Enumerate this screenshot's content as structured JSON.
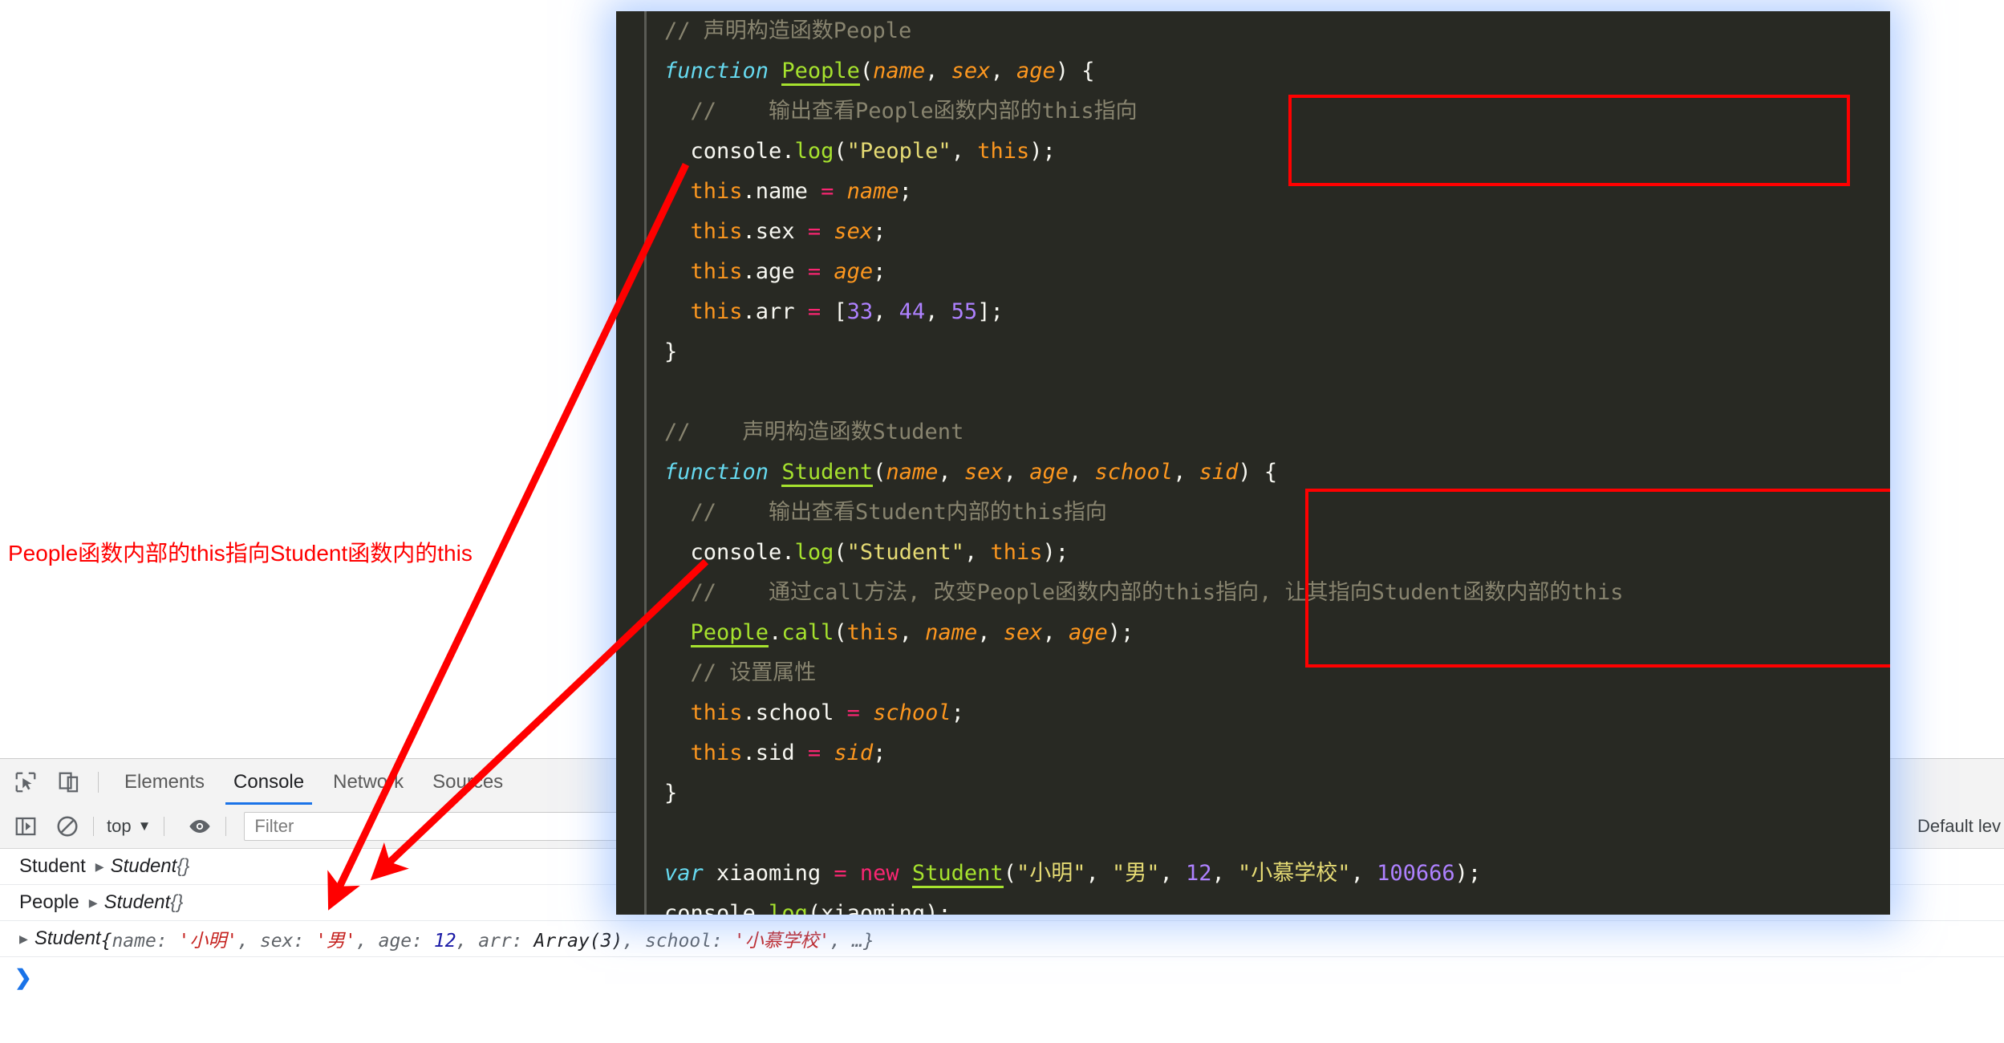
{
  "code_panel": {
    "language": "javascript",
    "background_color": "#282923",
    "glow_color": "#78aaff",
    "lines": [
      {
        "tokens": [
          {
            "t": "// 声明构造函数People",
            "c": "c-com"
          }
        ],
        "indent": 0
      },
      {
        "tokens": [
          {
            "t": "function ",
            "c": "c-kw"
          },
          {
            "t": "People",
            "c": "c-fn"
          },
          {
            "t": "(",
            "c": "c-punc"
          },
          {
            "t": "name",
            "c": "c-par"
          },
          {
            "t": ", ",
            "c": "c-punc"
          },
          {
            "t": "sex",
            "c": "c-par"
          },
          {
            "t": ", ",
            "c": "c-punc"
          },
          {
            "t": "age",
            "c": "c-par"
          },
          {
            "t": ") {",
            "c": "c-punc"
          }
        ],
        "indent": 0
      },
      {
        "tokens": [
          {
            "t": "//    输出查看People函数内部的this指向",
            "c": "c-com"
          }
        ],
        "indent": 1
      },
      {
        "tokens": [
          {
            "t": "console",
            "c": "c-plain"
          },
          {
            "t": ".",
            "c": "c-punc"
          },
          {
            "t": "log",
            "c": "c-fn2"
          },
          {
            "t": "(",
            "c": "c-punc"
          },
          {
            "t": "\"People\"",
            "c": "c-str"
          },
          {
            "t": ", ",
            "c": "c-punc"
          },
          {
            "t": "this",
            "c": "c-this"
          },
          {
            "t": ");",
            "c": "c-punc"
          }
        ],
        "indent": 1
      },
      {
        "tokens": [
          {
            "t": "this",
            "c": "c-this"
          },
          {
            "t": ".name ",
            "c": "c-plain"
          },
          {
            "t": "= ",
            "c": "c-op"
          },
          {
            "t": "name",
            "c": "c-par"
          },
          {
            "t": ";",
            "c": "c-punc"
          }
        ],
        "indent": 1
      },
      {
        "tokens": [
          {
            "t": "this",
            "c": "c-this"
          },
          {
            "t": ".sex ",
            "c": "c-plain"
          },
          {
            "t": "= ",
            "c": "c-op"
          },
          {
            "t": "sex",
            "c": "c-par"
          },
          {
            "t": ";",
            "c": "c-punc"
          }
        ],
        "indent": 1
      },
      {
        "tokens": [
          {
            "t": "this",
            "c": "c-this"
          },
          {
            "t": ".age ",
            "c": "c-plain"
          },
          {
            "t": "= ",
            "c": "c-op"
          },
          {
            "t": "age",
            "c": "c-par"
          },
          {
            "t": ";",
            "c": "c-punc"
          }
        ],
        "indent": 1
      },
      {
        "tokens": [
          {
            "t": "this",
            "c": "c-this"
          },
          {
            "t": ".arr ",
            "c": "c-plain"
          },
          {
            "t": "= ",
            "c": "c-op"
          },
          {
            "t": "[",
            "c": "c-punc"
          },
          {
            "t": "33",
            "c": "c-num"
          },
          {
            "t": ", ",
            "c": "c-punc"
          },
          {
            "t": "44",
            "c": "c-num"
          },
          {
            "t": ", ",
            "c": "c-punc"
          },
          {
            "t": "55",
            "c": "c-num"
          },
          {
            "t": "];",
            "c": "c-punc"
          }
        ],
        "indent": 1
      },
      {
        "tokens": [
          {
            "t": "}",
            "c": "c-punc"
          }
        ],
        "indent": 0
      },
      {
        "tokens": [
          {
            "t": "",
            "c": "c-plain"
          }
        ],
        "indent": 0
      },
      {
        "tokens": [
          {
            "t": "//    声明构造函数Student",
            "c": "c-com"
          }
        ],
        "indent": 0
      },
      {
        "tokens": [
          {
            "t": "function ",
            "c": "c-kw"
          },
          {
            "t": "Student",
            "c": "c-fn"
          },
          {
            "t": "(",
            "c": "c-punc"
          },
          {
            "t": "name",
            "c": "c-par"
          },
          {
            "t": ", ",
            "c": "c-punc"
          },
          {
            "t": "sex",
            "c": "c-par"
          },
          {
            "t": ", ",
            "c": "c-punc"
          },
          {
            "t": "age",
            "c": "c-par"
          },
          {
            "t": ", ",
            "c": "c-punc"
          },
          {
            "t": "school",
            "c": "c-par"
          },
          {
            "t": ", ",
            "c": "c-punc"
          },
          {
            "t": "sid",
            "c": "c-par"
          },
          {
            "t": ") {",
            "c": "c-punc"
          }
        ],
        "indent": 0
      },
      {
        "tokens": [
          {
            "t": "//    输出查看Student内部的this指向",
            "c": "c-com"
          }
        ],
        "indent": 1
      },
      {
        "tokens": [
          {
            "t": "console",
            "c": "c-plain"
          },
          {
            "t": ".",
            "c": "c-punc"
          },
          {
            "t": "log",
            "c": "c-fn2"
          },
          {
            "t": "(",
            "c": "c-punc"
          },
          {
            "t": "\"Student\"",
            "c": "c-str"
          },
          {
            "t": ", ",
            "c": "c-punc"
          },
          {
            "t": "this",
            "c": "c-this"
          },
          {
            "t": ");",
            "c": "c-punc"
          }
        ],
        "indent": 1
      },
      {
        "tokens": [
          {
            "t": "//    通过call方法, 改变People函数内部的this指向, 让其指向Student函数内部的this",
            "c": "c-com"
          }
        ],
        "indent": 1
      },
      {
        "tokens": [
          {
            "t": "People",
            "c": "c-fn"
          },
          {
            "t": ".",
            "c": "c-punc"
          },
          {
            "t": "call",
            "c": "c-fn2"
          },
          {
            "t": "(",
            "c": "c-punc"
          },
          {
            "t": "this",
            "c": "c-this"
          },
          {
            "t": ", ",
            "c": "c-punc"
          },
          {
            "t": "name",
            "c": "c-par"
          },
          {
            "t": ", ",
            "c": "c-punc"
          },
          {
            "t": "sex",
            "c": "c-par"
          },
          {
            "t": ", ",
            "c": "c-punc"
          },
          {
            "t": "age",
            "c": "c-par"
          },
          {
            "t": ");",
            "c": "c-punc"
          }
        ],
        "indent": 1
      },
      {
        "tokens": [
          {
            "t": "// 设置属性",
            "c": "c-com"
          }
        ],
        "indent": 1
      },
      {
        "tokens": [
          {
            "t": "this",
            "c": "c-this"
          },
          {
            "t": ".school ",
            "c": "c-plain"
          },
          {
            "t": "= ",
            "c": "c-op"
          },
          {
            "t": "school",
            "c": "c-par"
          },
          {
            "t": ";",
            "c": "c-punc"
          }
        ],
        "indent": 1
      },
      {
        "tokens": [
          {
            "t": "this",
            "c": "c-this"
          },
          {
            "t": ".sid ",
            "c": "c-plain"
          },
          {
            "t": "= ",
            "c": "c-op"
          },
          {
            "t": "sid",
            "c": "c-par"
          },
          {
            "t": ";",
            "c": "c-punc"
          }
        ],
        "indent": 1
      },
      {
        "tokens": [
          {
            "t": "}",
            "c": "c-punc"
          }
        ],
        "indent": 0
      },
      {
        "tokens": [
          {
            "t": "",
            "c": "c-plain"
          }
        ],
        "indent": 0
      },
      {
        "tokens": [
          {
            "t": "var ",
            "c": "c-kw"
          },
          {
            "t": "xiaoming ",
            "c": "c-plain"
          },
          {
            "t": "= ",
            "c": "c-op"
          },
          {
            "t": "new ",
            "c": "c-op"
          },
          {
            "t": "Student",
            "c": "c-fn"
          },
          {
            "t": "(",
            "c": "c-punc"
          },
          {
            "t": "\"小明\"",
            "c": "c-str"
          },
          {
            "t": ", ",
            "c": "c-punc"
          },
          {
            "t": "\"男\"",
            "c": "c-str"
          },
          {
            "t": ", ",
            "c": "c-punc"
          },
          {
            "t": "12",
            "c": "c-num"
          },
          {
            "t": ", ",
            "c": "c-punc"
          },
          {
            "t": "\"小慕学校\"",
            "c": "c-str"
          },
          {
            "t": ", ",
            "c": "c-punc"
          },
          {
            "t": "100666",
            "c": "c-num"
          },
          {
            "t": ");",
            "c": "c-punc"
          }
        ],
        "indent": 0
      },
      {
        "tokens": [
          {
            "t": "console",
            "c": "c-plain"
          },
          {
            "t": ".",
            "c": "c-punc"
          },
          {
            "t": "log",
            "c": "c-fn2"
          },
          {
            "t": "(",
            "c": "c-punc"
          },
          {
            "t": "xiaoming",
            "c": "c-plain"
          },
          {
            "t": ");",
            "c": "c-punc"
          }
        ],
        "indent": 0
      }
    ]
  },
  "annotations": {
    "note_text": "People函数内部的this指向Student函数内的this",
    "note_color": "#ff0000",
    "box_color": "#ff0000",
    "boxes": [
      {
        "name": "people-this-highlight"
      },
      {
        "name": "student-this-highlight"
      }
    ]
  },
  "devtools": {
    "tabs": [
      {
        "label": "Elements",
        "active": false
      },
      {
        "label": "Console",
        "active": true
      },
      {
        "label": "Network",
        "active": false
      },
      {
        "label": "Sources",
        "active": false
      }
    ],
    "toolbar": {
      "context_selector": "top",
      "context_caret": "▼",
      "filter_placeholder": "Filter",
      "level_label": "Default lev"
    },
    "messages": [
      {
        "label": "Student",
        "disclosure": "▶",
        "object_name": "Student",
        "object_body": " {}",
        "parts": []
      },
      {
        "label": "People",
        "disclosure": "▶",
        "object_name": "Student",
        "object_body": " {}",
        "parts": []
      },
      {
        "label": "",
        "disclosure": "▶",
        "object_name": "Student",
        "object_body": "",
        "parts": [
          {
            "t": " {",
            "c": "s-plain"
          },
          {
            "t": "name",
            "c": "s-key"
          },
          {
            "t": ": ",
            "c": "s-key"
          },
          {
            "t": "'小明'",
            "c": "s-str"
          },
          {
            "t": ", ",
            "c": "s-key"
          },
          {
            "t": "sex",
            "c": "s-key"
          },
          {
            "t": ": ",
            "c": "s-key"
          },
          {
            "t": "'男'",
            "c": "s-str"
          },
          {
            "t": ", ",
            "c": "s-key"
          },
          {
            "t": "age",
            "c": "s-key"
          },
          {
            "t": ": ",
            "c": "s-key"
          },
          {
            "t": "12",
            "c": "s-num"
          },
          {
            "t": ", ",
            "c": "s-key"
          },
          {
            "t": "arr",
            "c": "s-key"
          },
          {
            "t": ": ",
            "c": "s-key"
          },
          {
            "t": "Array(3)",
            "c": "s-plain"
          },
          {
            "t": ", ",
            "c": "s-key"
          },
          {
            "t": "school",
            "c": "s-key"
          },
          {
            "t": ": ",
            "c": "s-key"
          },
          {
            "t": "'小慕学校'",
            "c": "s-str"
          },
          {
            "t": ", …}",
            "c": "s-key"
          }
        ]
      }
    ],
    "prompt_chevron": "❯"
  }
}
